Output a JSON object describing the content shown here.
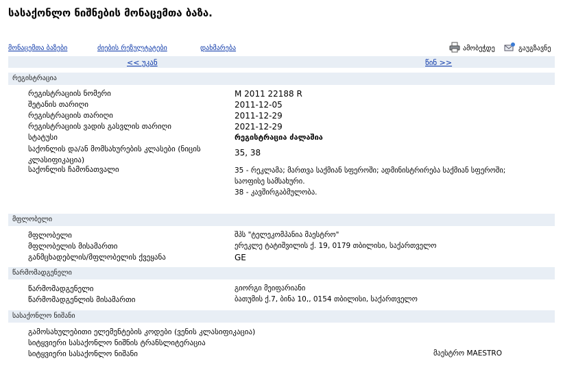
{
  "page": {
    "title": "სასაქონლო ნიშნების მონაცემთა ბაზა."
  },
  "nav": {
    "database_link": "მონაცემთა ბაზები",
    "results_link": "ძიების რეზულტატები",
    "help_link": "დახმარება",
    "print_label": "ამობეჭდე",
    "send_label": "გაუგზავნე"
  },
  "pager": {
    "back": "<< უკან",
    "forward": "წინ >>"
  },
  "registration": {
    "header": "რეგისტრაცია",
    "fields": [
      {
        "label": "რეგისტრაციის ნომერი",
        "value": "M 2011 22188 R"
      },
      {
        "label": "შეტანის თარიღი",
        "value": "2011-12-05"
      },
      {
        "label": "რეგისტრაციის თარიღი",
        "value": "2011-12-29"
      },
      {
        "label": "რეგისტრაციის ვადის გასვლის თარიღი",
        "value": "2021-12-29"
      },
      {
        "label": "სტატუსი",
        "value": "რეგისტრაცია ძალაშია"
      },
      {
        "label": "საქონლის და/ან მომსახურების კლასები (ნიცის კლასიფიკაცია)",
        "value": "35, 38"
      },
      {
        "label": "საქონლის ჩამონათვალი",
        "value": "35 - რეკლამა; მართვა საქმიან სფეროში; ადმინისტრირება საქმიან სფეროში; საოფისე სამსახური.\n38 - კავშირგაბმულობა."
      }
    ]
  },
  "owner": {
    "header": "მფლობელი",
    "fields": [
      {
        "label": "მფლობელი",
        "value": "შპს \"ტელეკომპანია მაესტრო\""
      },
      {
        "label": "მფლობელის მისამართი",
        "value": "ერეკლე ტატიშვილის ქ. 19, 0179 თბილისი, საქართველო"
      },
      {
        "label": "განმცხადებლის/მფლობელის ქვეყანა",
        "value": "GE"
      }
    ]
  },
  "representative": {
    "header": "წარმომადგენელი",
    "fields": [
      {
        "label": "წარმომადგენელი",
        "value": "გიორგი მეიფარიანი"
      },
      {
        "label": "წარმომადგენლის მისამართი",
        "value": "ბათუმის ქ.7, ბინა 10,, 0154 თბილისი, საქართველო"
      }
    ]
  },
  "trademark": {
    "header": "სასაქონლო ნიშანი",
    "fields": [
      {
        "label": "გამოსახულებითი ელემენტების კოდები (ვენის კლასიფიკაცია)",
        "value": ""
      },
      {
        "label": "სიტყვიერი სასაქონლო ნიშნის ტრანსლიტერაცია",
        "value": ""
      },
      {
        "label": "სიტყვიერი სასაქონლო ნიშანი",
        "value": "მაესტრო MAESTRO"
      }
    ]
  }
}
